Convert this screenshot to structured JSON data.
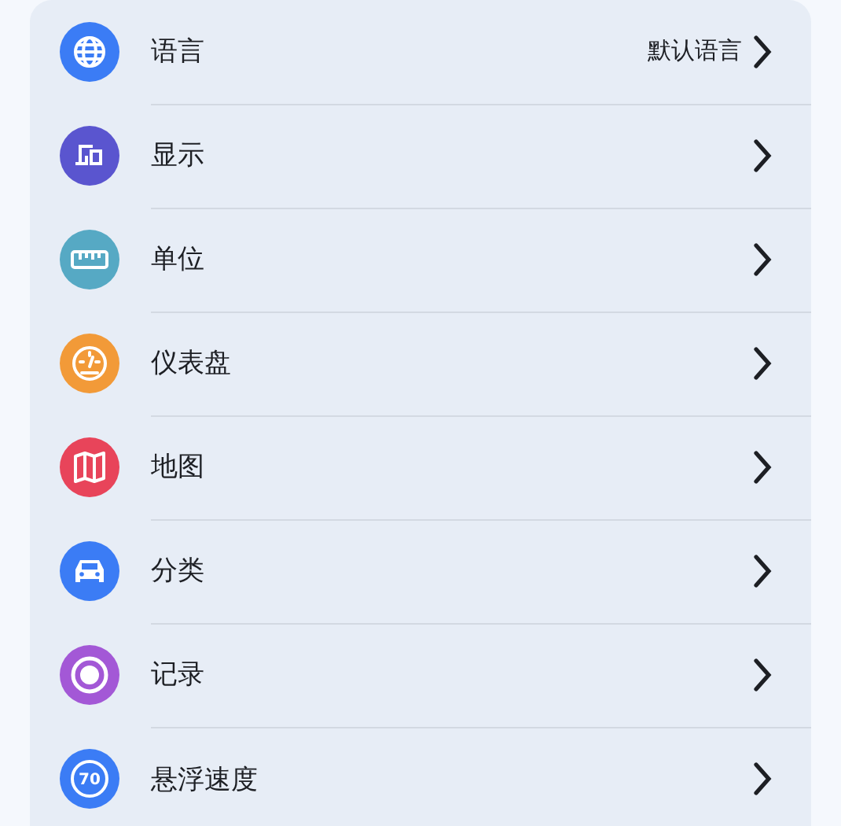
{
  "settings": [
    {
      "kind": "globe",
      "color": "#3b7cf5",
      "label": "语言",
      "value": "默认语言"
    },
    {
      "kind": "display",
      "color": "#5a55cf",
      "label": "显示"
    },
    {
      "kind": "ruler",
      "color": "#56a9c4",
      "label": "单位"
    },
    {
      "kind": "gauge",
      "color": "#f29a38",
      "label": "仪表盘"
    },
    {
      "kind": "map",
      "color": "#e8445a",
      "label": "地图"
    },
    {
      "kind": "car",
      "color": "#3b7cf5",
      "label": "分类"
    },
    {
      "kind": "record",
      "color": "#a358d6",
      "label": "记录"
    },
    {
      "kind": "speed",
      "color": "#3b7cf5",
      "label": "悬浮速度",
      "icon_text": "70"
    }
  ]
}
